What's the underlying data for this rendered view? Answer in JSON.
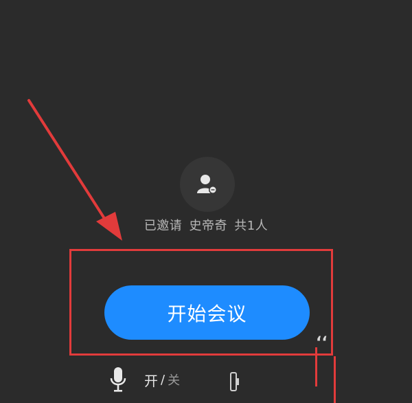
{
  "invite": {
    "prefix": "已邀请",
    "name": "史帝奇",
    "count": "共1人"
  },
  "start_button": {
    "label": "开始会议"
  },
  "mic": {
    "on_label": "开",
    "separator": "/",
    "off_label": "关"
  },
  "icons": {
    "avatar": "add-user-icon",
    "mic": "microphone-icon",
    "camera": "camera-icon"
  },
  "colors": {
    "background": "#2b2b2b",
    "button": "#1e8cff",
    "annotation": "#e23b3b"
  }
}
